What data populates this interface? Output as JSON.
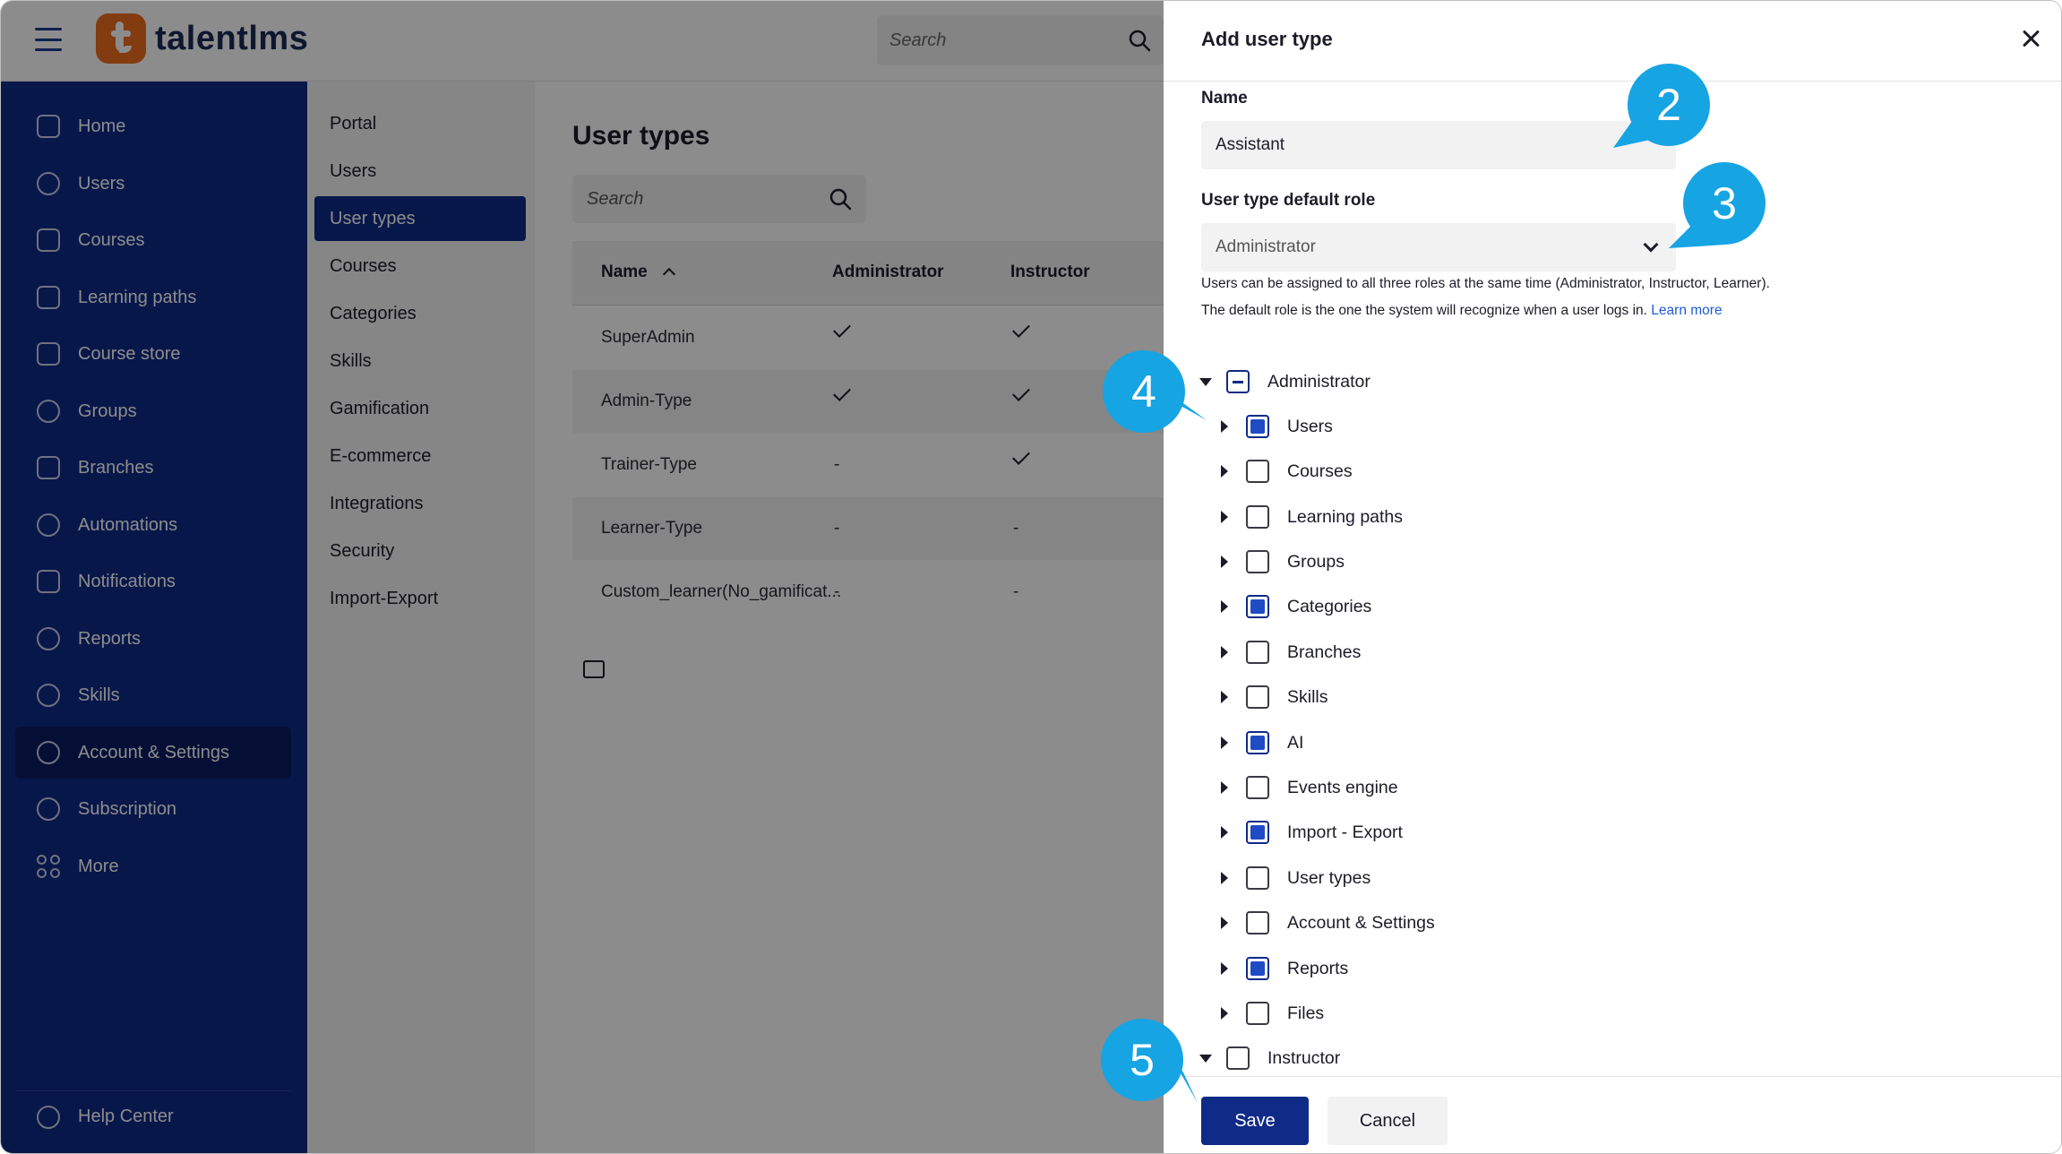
{
  "app": {
    "logo_text": "talentlms",
    "search_placeholder": "Search"
  },
  "sidebar": {
    "items": [
      {
        "label": "Home",
        "icon": "home-icon"
      },
      {
        "label": "Users",
        "icon": "user-icon"
      },
      {
        "label": "Courses",
        "icon": "book-icon"
      },
      {
        "label": "Learning paths",
        "icon": "path-icon"
      },
      {
        "label": "Course store",
        "icon": "store-icon"
      },
      {
        "label": "Groups",
        "icon": "groups-icon"
      },
      {
        "label": "Branches",
        "icon": "layers-icon"
      },
      {
        "label": "Automations",
        "icon": "automation-icon"
      },
      {
        "label": "Notifications",
        "icon": "megaphone-icon"
      },
      {
        "label": "Reports",
        "icon": "pie-chart-icon"
      },
      {
        "label": "Skills",
        "icon": "globe-icon"
      },
      {
        "label": "Account & Settings",
        "icon": "gear-icon",
        "active": true
      },
      {
        "label": "Subscription",
        "icon": "refresh-icon"
      },
      {
        "label": "More",
        "icon": "grid-icon"
      }
    ],
    "help_label": "Help Center"
  },
  "submenu": {
    "items": [
      "Portal",
      "Users",
      "User types",
      "Courses",
      "Categories",
      "Skills",
      "Gamification",
      "E-commerce",
      "Integrations",
      "Security",
      "Import-Export"
    ],
    "active": "User types"
  },
  "main": {
    "title": "User types",
    "search_placeholder": "Search",
    "columns": [
      "Name",
      "Administrator",
      "Instructor"
    ],
    "rows": [
      {
        "name": "SuperAdmin",
        "admin": "✓",
        "instructor": "✓"
      },
      {
        "name": "Admin-Type",
        "admin": "✓",
        "instructor": "✓"
      },
      {
        "name": "Trainer-Type",
        "admin": "-",
        "instructor": "✓"
      },
      {
        "name": "Learner-Type",
        "admin": "-",
        "instructor": "-"
      },
      {
        "name": "Custom_learner(No_gamificat...",
        "admin": "-",
        "instructor": "-"
      }
    ]
  },
  "drawer": {
    "title": "Add user type",
    "name_label": "Name",
    "name_value": "Assistant",
    "role_label": "User type default role",
    "role_value": "Administrator",
    "help_line1": "Users can be assigned to all three roles at the same time (Administrator, Instructor, Learner).",
    "help_line2": "The default role is the one the system will recognize when a user logs in.",
    "learn_more": "Learn more",
    "tree": {
      "root": "Administrator",
      "children": [
        {
          "label": "Users",
          "checked": true
        },
        {
          "label": "Courses",
          "checked": false
        },
        {
          "label": "Learning paths",
          "checked": false
        },
        {
          "label": "Groups",
          "checked": false
        },
        {
          "label": "Categories",
          "checked": true
        },
        {
          "label": "Branches",
          "checked": false
        },
        {
          "label": "Skills",
          "checked": false
        },
        {
          "label": "AI",
          "checked": true
        },
        {
          "label": "Events engine",
          "checked": false
        },
        {
          "label": "Import - Export",
          "checked": true
        },
        {
          "label": "User types",
          "checked": false
        },
        {
          "label": "Account & Settings",
          "checked": false
        },
        {
          "label": "Reports",
          "checked": true
        },
        {
          "label": "Files",
          "checked": false
        }
      ],
      "second_root": "Instructor"
    },
    "save_label": "Save",
    "cancel_label": "Cancel"
  },
  "callouts": [
    "2",
    "3",
    "4",
    "5"
  ],
  "colors": {
    "sidebar": "#0f2a87",
    "accent": "#1f4bc4",
    "callout": "#17a4e3",
    "logo": "#ee6c1e"
  }
}
